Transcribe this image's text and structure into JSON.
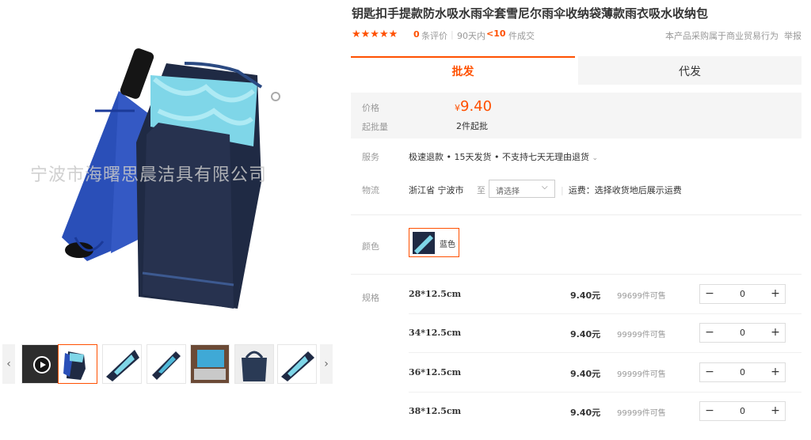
{
  "gallery": {
    "watermark": "宁波市海曙思晨洁具有限公司",
    "prev_arrow": "‹",
    "next_arrow": "›",
    "thumbnails": [
      "video",
      "image-1",
      "image-2",
      "image-3",
      "image-4",
      "image-5",
      "image-6"
    ]
  },
  "product": {
    "title": "钥匙扣手提款防水吸水雨伞套雪尼尔雨伞收纳袋薄款雨衣吸水收纳包",
    "stars": "★★★★★",
    "review_count": "0",
    "review_label": "条评价",
    "separator": "|",
    "deal_prefix": "90天内",
    "deal_count": "<10",
    "deal_label": "件成交",
    "purchase_notice": "本产品采购属于商业贸易行为",
    "report_label": "举报"
  },
  "tabs": [
    {
      "label": "批发",
      "active": true
    },
    {
      "label": "代发",
      "active": false
    }
  ],
  "pricing": {
    "price_label": "价格",
    "currency": "¥",
    "price": "9.40",
    "moq_label": "起批量",
    "moq": "2件起批"
  },
  "service": {
    "label": "服务",
    "text": "极速退款 • 15天发货 • 不支持七天无理由退货",
    "chevron": "⌄"
  },
  "logistics": {
    "label": "物流",
    "origin": "浙江省 宁波市",
    "to": "至",
    "select_placeholder": "请选择",
    "select_arrow": "⌵",
    "shipping": "运费：选择收货地后展示运费",
    "bar": "|"
  },
  "color": {
    "label": "颜色",
    "option": "蓝色"
  },
  "specs": {
    "label": "规格",
    "rows": [
      {
        "size": "28*12.5cm",
        "price": "9.40元",
        "stock": "99699件可售",
        "qty": "0"
      },
      {
        "size": "34*12.5cm",
        "price": "9.40元",
        "stock": "99999件可售",
        "qty": "0"
      },
      {
        "size": "36*12.5cm",
        "price": "9.40元",
        "stock": "99999件可售",
        "qty": "0"
      },
      {
        "size": "38*12.5cm",
        "price": "9.40元",
        "stock": "99999件可售",
        "qty": "0"
      }
    ],
    "minus": "−",
    "plus": "+"
  },
  "colors": {
    "accent": "#ff5000",
    "price_bg": "#f5f5f5",
    "umbrella_blue": "#2a4fb8",
    "towel_cyan": "#7fd6e8",
    "pouch_navy": "#1f2a44"
  }
}
